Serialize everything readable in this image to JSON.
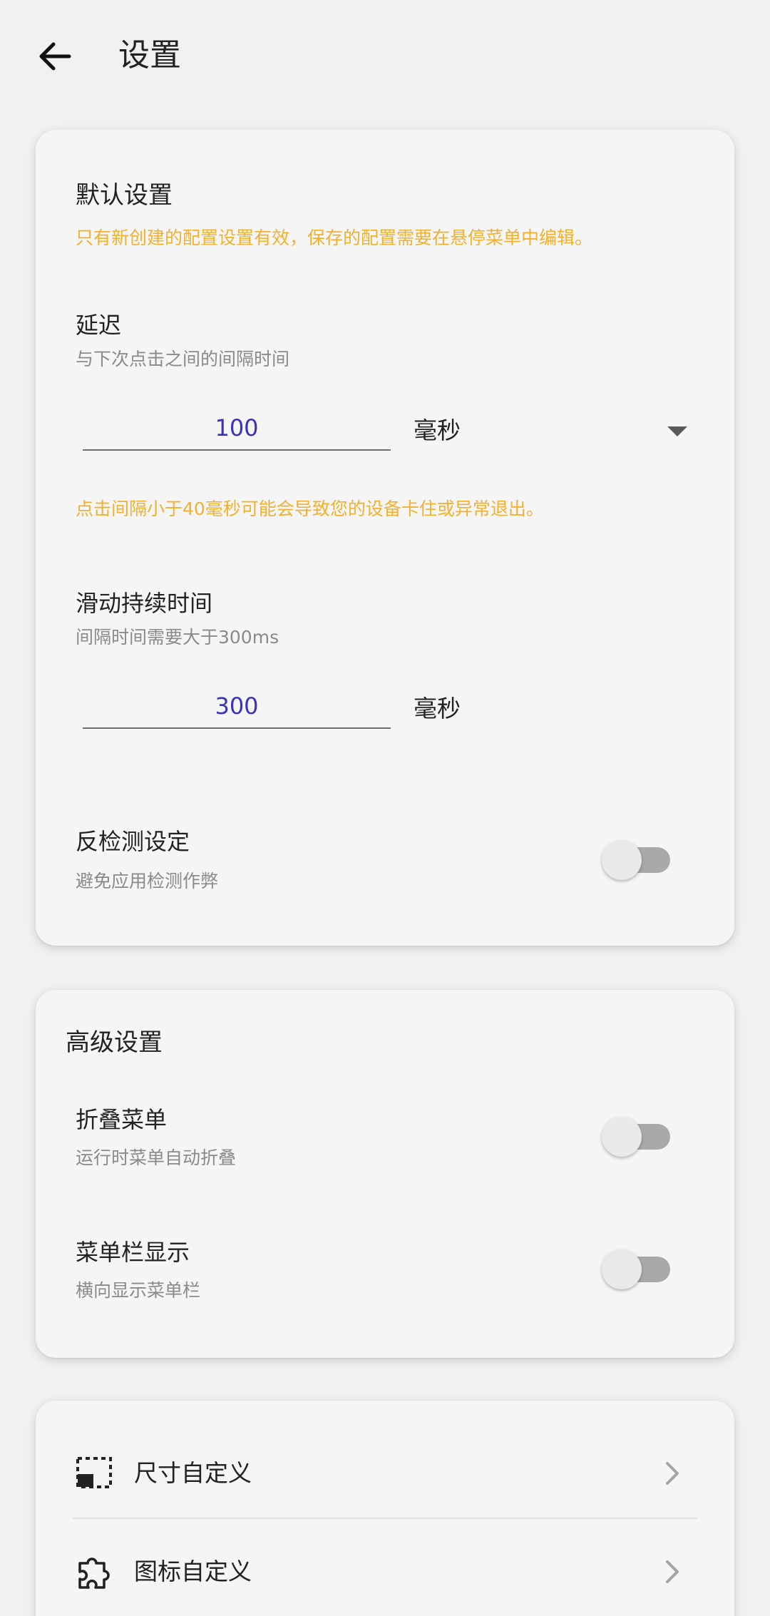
{
  "header": {
    "title": "设置",
    "back_icon": "arrow-left-icon"
  },
  "default_settings": {
    "title": "默认设置",
    "notice": "只有新创建的配置设置有效，保存的配置需要在悬停菜单中编辑。",
    "delay": {
      "title": "延迟",
      "subtitle": "与下次点击之间的间隔时间",
      "value": "100",
      "unit": "毫秒",
      "warning": "点击间隔小于40毫秒可能会导致您的设备卡住或异常退出。"
    },
    "swipe_duration": {
      "title": "滑动持续时间",
      "subtitle": "间隔时间需要大于300ms",
      "value": "300",
      "unit": "毫秒"
    },
    "anti_detection": {
      "title": "反检测设定",
      "subtitle": "避免应用检测作弊",
      "enabled": false
    }
  },
  "advanced_settings": {
    "title": "高级设置",
    "collapse_menu": {
      "title": "折叠菜单",
      "subtitle": "运行时菜单自动折叠",
      "enabled": false
    },
    "menu_bar_display": {
      "title": "菜单栏显示",
      "subtitle": "横向显示菜单栏",
      "enabled": false
    }
  },
  "customization": {
    "items": [
      {
        "label": "尺寸自定义",
        "icon": "resize-frame-icon"
      },
      {
        "label": "图标自定义",
        "icon": "puzzle-icon"
      }
    ]
  },
  "colors": {
    "warning": "#f0b22e",
    "input_text": "#3a32b8",
    "background": "#f1f1f1",
    "card": "#f5f5f5"
  }
}
